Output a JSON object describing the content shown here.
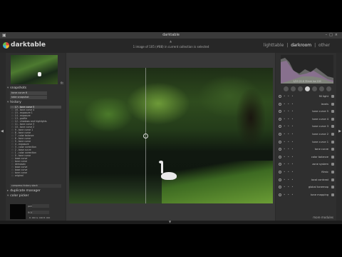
{
  "window": {
    "title": "darktable"
  },
  "header": {
    "brand": "darktable",
    "info": "1 image of 105 (#88) in current collection is selected",
    "views": [
      "lighttable",
      "darkroom",
      "other"
    ],
    "separators": [
      "|",
      "|"
    ],
    "active_view": "darkroom"
  },
  "left_panel": {
    "zoom": "fit",
    "snapshots": {
      "label": "snapshots",
      "items": [
        "tone curve 6",
        "take snapshot"
      ]
    },
    "history": {
      "label": "history",
      "items": [
        "17 - tone curve 5",
        "16 - tone curve 4",
        "15 - exposure 1",
        "14 - exposure",
        "13 - profile",
        "12 - shadows and highlights",
        "11 - tone curve 3",
        "10 - tone curve 2",
        "9 - tone curve 1",
        "8 - tone curve",
        "7 - color balance",
        "6 - tone curve",
        "5 - tone curve",
        "4 - exposure",
        "3 - color correction",
        "2 - base curve",
        "1 - color correction",
        "0 - tone curve",
        "base curve",
        "tone curve",
        "demosaic",
        "base curve",
        "base curve",
        "tone curve",
        "original"
      ],
      "compress": "compress history stack"
    },
    "duplicate": {
      "label": "duplicate manager"
    },
    "color_picker": {
      "label": "color picker",
      "mode_label": "point",
      "model_label": "RGB",
      "values": "R: 000  G: 000  B: 000",
      "restrict": "restrict histogram to selection",
      "display": "display sample areas on image",
      "sample": "mean",
      "add_sample": "add sample"
    }
  },
  "right_panel": {
    "histogram_info": "1/25 f/2.8 35mm iso 100",
    "modules": [
      "fill light",
      "levels",
      "tone curve 5",
      "tone curve 4",
      "tone curve 3",
      "tone curve 2",
      "tone curve 1",
      "tone curve",
      "color balance",
      "zone system",
      "filmic",
      "local contrast",
      "global tonemap",
      "tone mapping"
    ],
    "more_modules": "more modules"
  },
  "icons": {
    "power": "power-icon",
    "collapse_left": "chevron-left-icon",
    "collapse_right": "chevron-right-icon"
  }
}
